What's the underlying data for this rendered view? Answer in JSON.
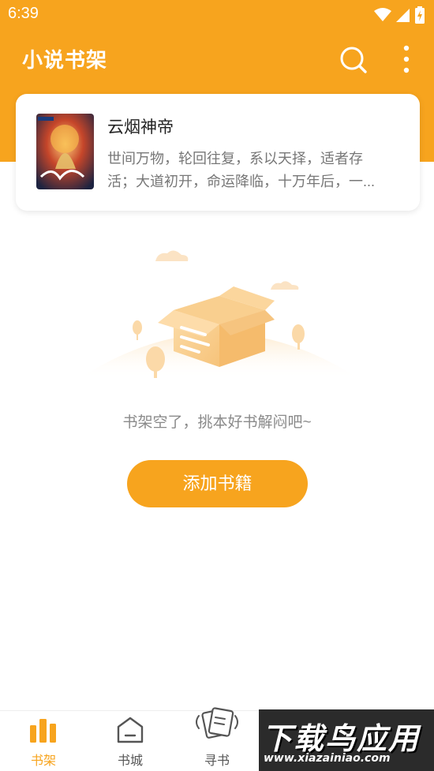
{
  "status_bar": {
    "time": "6:39"
  },
  "app_bar": {
    "title": "小说书架"
  },
  "book": {
    "title": "云烟神帝",
    "description_line1": "世间万物，轮回往复，系以天择，适者存",
    "description_line2": "活；大道初开，命运降临，十万年后，一..."
  },
  "empty_state": {
    "message": "书架空了，挑本好书解闷吧~",
    "add_button": "添加书籍"
  },
  "bottom_nav": {
    "items": [
      {
        "label": "书架",
        "icon": "bookshelf-icon",
        "active": true
      },
      {
        "label": "书城",
        "icon": "store-icon",
        "active": false
      },
      {
        "label": "寻书",
        "icon": "find-book-icon",
        "active": false
      }
    ]
  },
  "watermark": {
    "title": "下载鸟应用",
    "url": "www.xiazainiao.com"
  },
  "colors": {
    "accent": "#f7a41e",
    "text_muted": "#8a8a8a"
  }
}
